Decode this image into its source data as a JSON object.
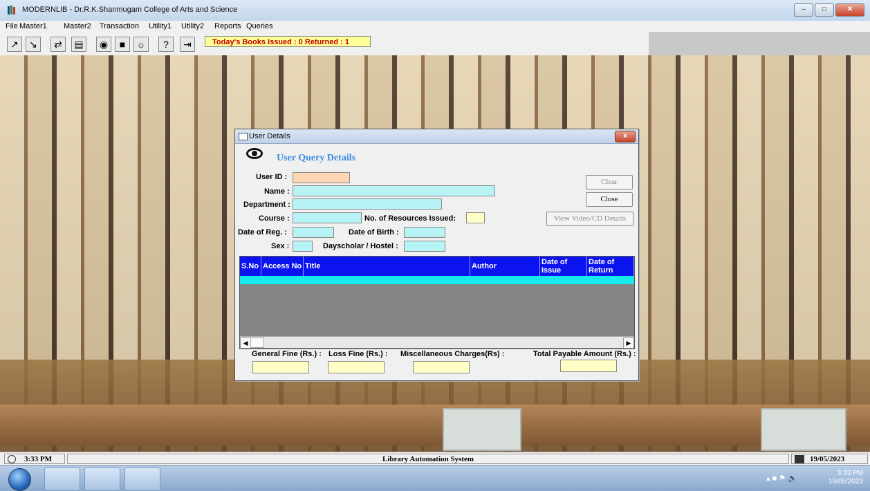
{
  "window": {
    "title": "MODERNLIB - Dr.R.K.Shanmugam College of Arts and Science"
  },
  "menu": [
    "File",
    "Master1",
    "Master2",
    "Transaction",
    "Utility1",
    "Utility2",
    "Reports",
    "Queries"
  ],
  "toolbar": {
    "icons": [
      "book-in-icon",
      "book-out-icon",
      "transfer-icon",
      "report-icon",
      "eye-icon",
      "book-icon",
      "globe-icon",
      "help-icon",
      "exit-icon"
    ],
    "today_message": "Today's Books Issued : 0 Returned : 1"
  },
  "dialog": {
    "title": "User Details",
    "close_label": "x",
    "heading": "User Query Details",
    "labels": {
      "user_id": "User ID :",
      "name": "Name :",
      "department": "Department :",
      "course": "Course :",
      "resources": "No. of Resources Issued:",
      "date_reg": "Date of Reg. :",
      "dob": "Date of Birth :",
      "sex": "Sex :",
      "dayscholar": "Dayscholar / Hostel :"
    },
    "values": {
      "user_id": "",
      "name": "",
      "department": "",
      "course": "",
      "resources": "",
      "date_reg": "",
      "dob": "",
      "sex": "",
      "dayscholar": ""
    },
    "buttons": {
      "clear": "Clear",
      "close": "Close",
      "view_video": "View Video/CD Details"
    },
    "grid": {
      "columns": [
        "S.No",
        "Access No",
        "Title",
        "Author",
        "Date of Issue",
        "Date of Return"
      ],
      "rows": []
    },
    "fines": {
      "general": "General Fine (Rs.) :",
      "loss": "Loss Fine (Rs.) :",
      "misc": "Miscellaneous Charges(Rs) :",
      "total": "Total Payable Amount (Rs.) :"
    }
  },
  "status": {
    "time": "3:33 PM",
    "system": "Library Automation System",
    "date": "19/05/2023"
  },
  "taskbar": {
    "clock_time": "3:33 PM",
    "clock_date": "19/05/2023"
  },
  "colors": {
    "grid_header": "#0b14ef",
    "grid_row": "#18e9ed",
    "input_cyan": "#b7f3f4",
    "input_yellow": "#ffffc5",
    "heading": "#3d8be2"
  }
}
